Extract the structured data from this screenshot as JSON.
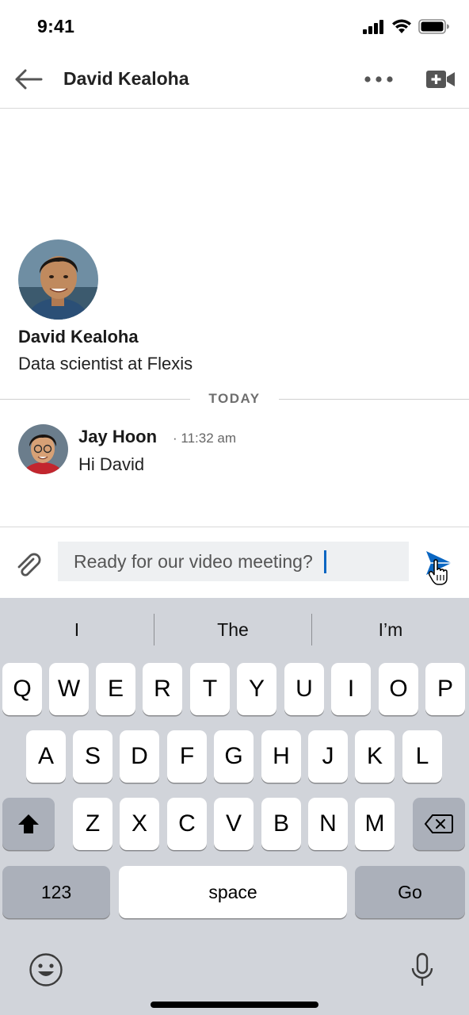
{
  "status_bar": {
    "time": "9:41"
  },
  "header": {
    "title": "David Kealoha"
  },
  "profile": {
    "name": "David Kealoha",
    "headline": "Data scientist at Flexis"
  },
  "divider": {
    "label": "TODAY"
  },
  "message": {
    "sender": "Jay Hoon",
    "time": "· 11:32 am",
    "text": "Hi David"
  },
  "compose": {
    "value": "Ready for our video meeting?"
  },
  "keyboard": {
    "suggestions": [
      "I",
      "The",
      "I’m"
    ],
    "row1": [
      "Q",
      "W",
      "E",
      "R",
      "T",
      "Y",
      "U",
      "I",
      "O",
      "P"
    ],
    "row2": [
      "A",
      "S",
      "D",
      "F",
      "G",
      "H",
      "J",
      "K",
      "L"
    ],
    "row3": [
      "Z",
      "X",
      "C",
      "V",
      "B",
      "N",
      "M"
    ],
    "numbers_label": "123",
    "space_label": "space",
    "go_label": "Go"
  },
  "colors": {
    "accent": "#0a66c2",
    "keyboard_bg": "#d1d4da",
    "dark_key": "#abb0ba"
  },
  "icons": [
    "back-arrow-icon",
    "more-icon",
    "video-call-icon",
    "paperclip-icon",
    "send-icon",
    "hand-cursor-icon",
    "shift-icon",
    "backspace-icon",
    "emoji-icon",
    "microphone-icon",
    "signal-icon",
    "wifi-icon",
    "battery-icon"
  ]
}
